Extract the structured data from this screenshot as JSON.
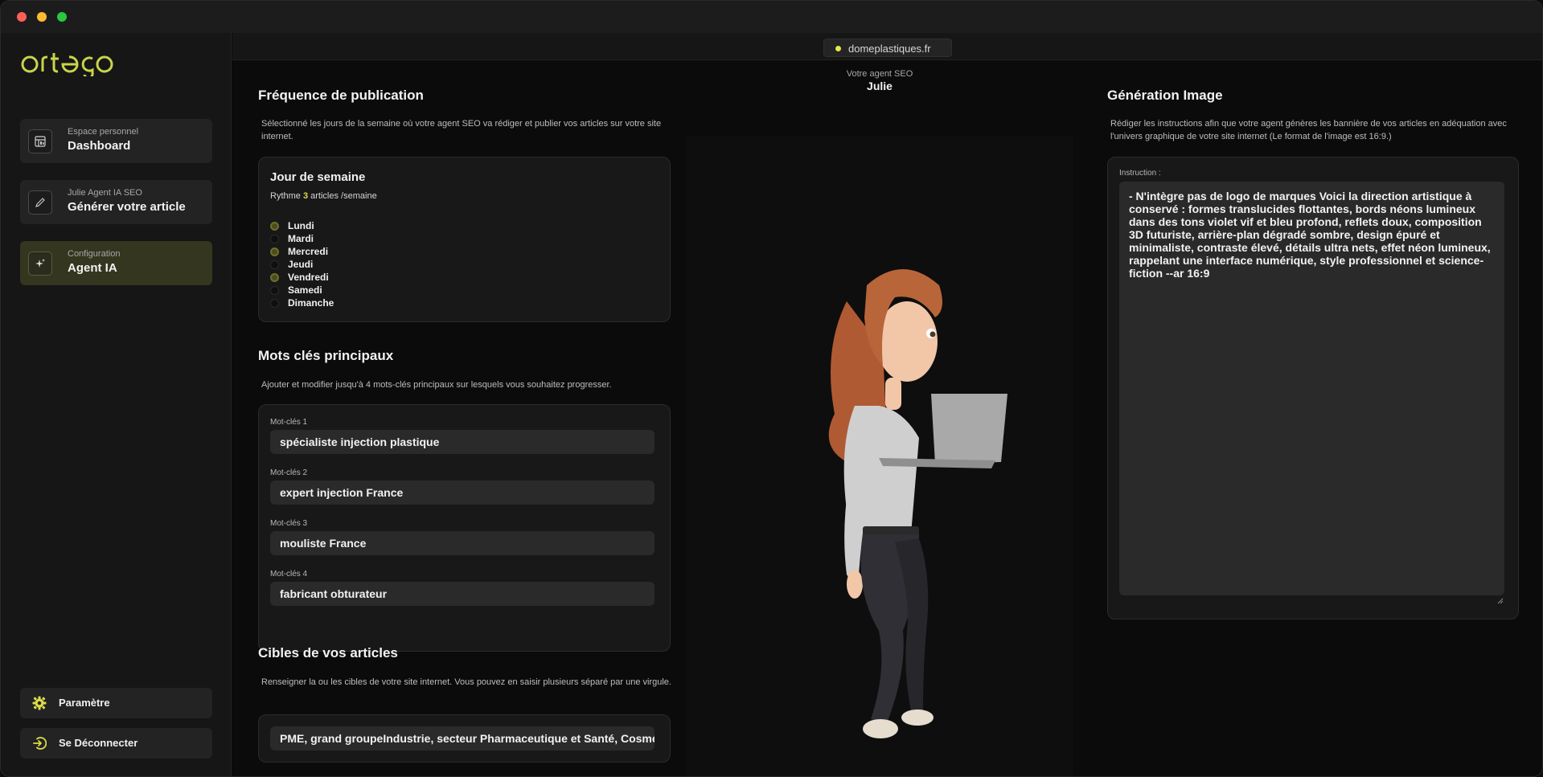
{
  "app": {
    "logo_text": "ortego",
    "domain": "domeplastiques.fr"
  },
  "sidebar": {
    "items": [
      {
        "sub": "Espace personnel",
        "label": "Dashboard",
        "icon": "dashboard-icon"
      },
      {
        "sub": "Julie Agent IA SEO",
        "label": "Générer votre article",
        "icon": "pen-icon"
      },
      {
        "sub": "Configuration",
        "label": "Agent IA",
        "icon": "sparkle-icon",
        "active": true
      }
    ],
    "settings_label": "Paramètre",
    "logout_label": "Se Déconnecter"
  },
  "frequency": {
    "title": "Fréquence de publication",
    "description": "Sélectionné les jours de la semaine où votre agent SEO va rédiger et publier vos articles sur votre site internet.",
    "card_title": "Jour de semaine",
    "rhythm_prefix": "Rythme",
    "rhythm_count": "3",
    "rhythm_suffix": "articles /semaine",
    "days": [
      {
        "label": "Lundi",
        "checked": true
      },
      {
        "label": "Mardi",
        "checked": false
      },
      {
        "label": "Mercredi",
        "checked": true
      },
      {
        "label": "Jeudi",
        "checked": false
      },
      {
        "label": "Vendredi",
        "checked": true
      },
      {
        "label": "Samedi",
        "checked": false
      },
      {
        "label": "Dimanche",
        "checked": false
      }
    ]
  },
  "keywords": {
    "title": "Mots clés principaux",
    "description": "Ajouter et modifier jusqu'à 4 mots-clés principaux sur lesquels vous souhaitez progresser.",
    "fields": [
      {
        "label": "Mot-clés 1",
        "value": "spécialiste injection plastique"
      },
      {
        "label": "Mot-clés 2",
        "value": "expert injection France"
      },
      {
        "label": "Mot-clés 3",
        "value": "mouliste France"
      },
      {
        "label": "Mot-clés 4",
        "value": "fabricant obturateur"
      }
    ]
  },
  "targets": {
    "title": "Cibles de vos articles",
    "description": "Renseigner la ou les cibles de votre site internet. Vous pouvez en saisir plusieurs séparé par une virgule.",
    "value": "PME, grand groupeIndustrie, secteur Pharmaceutique et Santé, Cosmétique"
  },
  "agent": {
    "label": "Votre agent SEO",
    "name": "Julie"
  },
  "image_generation": {
    "title": "Génération Image",
    "description": "Rédiger les instructions afin que votre agent génères les bannière de vos articles en adéquation avec l'univers graphique de votre site internet (Le format de l'image est 16:9.)",
    "instruction_label": "Instruction :",
    "instruction_value": "- N'intègre pas de logo de marques Voici la direction artistique à conservé : formes translucides flottantes, bords néons lumineux dans des tons violet vif et bleu profond, reflets doux, composition 3D futuriste, arrière-plan dégradé sombre, design épuré et minimaliste, contraste élevé, détails ultra nets, effet néon lumineux, rappelant une interface numérique, style professionnel et science-fiction --ar 16:9"
  },
  "colors": {
    "accent": "#d9dd4a",
    "active_nav": "#34361f",
    "background": "#0b0b0b"
  }
}
